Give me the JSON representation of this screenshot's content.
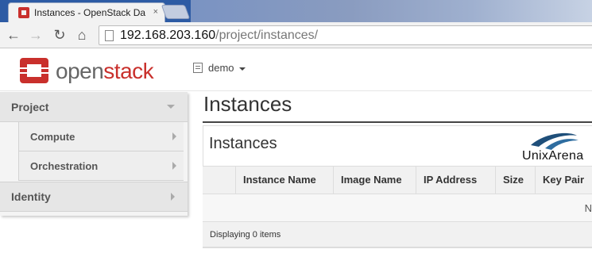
{
  "browser": {
    "tab_title": "Instances - OpenStack Da",
    "tab_close": "×",
    "url_host": "192.168.203.160",
    "url_path": "/project/instances/"
  },
  "header": {
    "brand_light": "open",
    "brand_strong": "stack",
    "project_name": "demo"
  },
  "sidebar": {
    "project_label": "Project",
    "items": [
      {
        "label": "Compute"
      },
      {
        "label": "Orchestration"
      }
    ],
    "identity_label": "Identity"
  },
  "main": {
    "page_title": "Instances",
    "table_title": "Instances",
    "watermark": "UnixArena",
    "columns": [
      "Instance Name",
      "Image Name",
      "IP Address",
      "Size",
      "Key Pair"
    ],
    "empty_message": "N",
    "footer": "Displaying 0 items"
  },
  "colors": {
    "brand_red": "#c9302c",
    "tab_strip": "#2d5ba4"
  }
}
